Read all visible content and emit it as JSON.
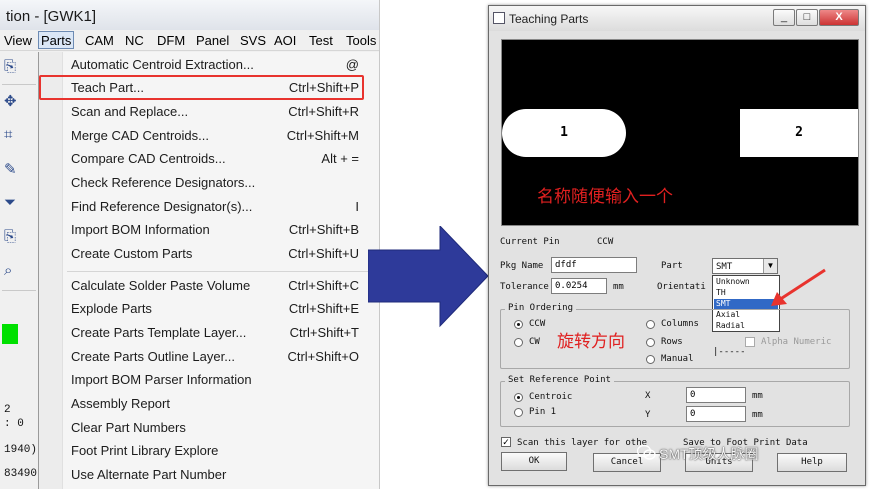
{
  "left_window": {
    "title": "tion - [GWK1]",
    "menubar": [
      "View",
      "Parts",
      "CAM",
      "NC",
      "DFM",
      "Panel",
      "SVS",
      "AOI",
      "Test",
      "Tools"
    ],
    "active_menu": "Parts",
    "toolbar_text": [
      "2",
      ": 0",
      "1940)",
      "83490)"
    ],
    "menu_items": [
      {
        "label": "Automatic Centroid Extraction...",
        "shortcut": "@"
      },
      {
        "label": "Teach Part...",
        "shortcut": "Ctrl+Shift+P"
      },
      {
        "label": "Scan and Replace...",
        "shortcut": "Ctrl+Shift+R"
      },
      {
        "label": "Merge CAD Centroids...",
        "shortcut": "Ctrl+Shift+M"
      },
      {
        "label": "Compare CAD Centroids...",
        "shortcut": "Alt + ="
      },
      {
        "label": "Check Reference Designators...",
        "shortcut": ""
      },
      {
        "label": "Find Reference Designator(s)...",
        "shortcut": "I"
      },
      {
        "label": "Import BOM Information",
        "shortcut": "Ctrl+Shift+B"
      },
      {
        "label": "Create Custom Parts",
        "shortcut": "Ctrl+Shift+U"
      },
      {
        "label": "Calculate Solder Paste Volume",
        "shortcut": "Ctrl+Shift+C"
      },
      {
        "label": "Explode Parts",
        "shortcut": "Ctrl+Shift+E"
      },
      {
        "label": "Create Parts Template Layer...",
        "shortcut": "Ctrl+Shift+T"
      },
      {
        "label": "Create Parts Outline Layer...",
        "shortcut": "Ctrl+Shift+O"
      },
      {
        "label": "Import BOM Parser Information",
        "shortcut": ""
      },
      {
        "label": "Assembly Report",
        "shortcut": ""
      },
      {
        "label": "Clear Part Numbers",
        "shortcut": ""
      },
      {
        "label": "Foot Print Library Explore",
        "shortcut": ""
      },
      {
        "label": "Use Alternate Part Number",
        "shortcut": ""
      }
    ],
    "highlighted_item": "Teach Part..."
  },
  "dialog": {
    "title": "Teaching Parts",
    "window_buttons": [
      "_",
      "□",
      "X"
    ],
    "preview": {
      "pad1": "1",
      "pad2": "2",
      "note": "名称随便输入一个"
    },
    "current_pin_label": "Current Pin",
    "current_pin_value": "CCW",
    "pkg_name_label": "Pkg Name",
    "pkg_name_value": "dfdf",
    "part_label": "Part",
    "part_value": "SMT",
    "part_options": [
      "Unknown",
      "TH",
      "SMT",
      "Axial",
      "Radial"
    ],
    "part_selected": "SMT",
    "tolerance_label": "Tolerance",
    "tolerance_value": "0.0254",
    "tolerance_unit": "mm",
    "orientation_label": "Orientati",
    "pin_ordering": {
      "title": "Pin Ordering",
      "ccw": "CCW",
      "cw": "CW",
      "columns": "Columns",
      "rows": "Rows",
      "manual": "Manual",
      "alpha_numeric": "Alpha Numeric",
      "separator": "|-----",
      "note": "旋转方向"
    },
    "ref_point": {
      "title": "Set Reference Point",
      "centroid": "Centroic",
      "pin1": "Pin 1",
      "x_label": "X",
      "x_value": "0",
      "y_label": "Y",
      "y_value": "0",
      "unit": "mm"
    },
    "scan_label": "Scan this layer for othe",
    "save_label": "Save to Foot Print Data",
    "buttons": {
      "ok": "OK",
      "cancel": "Cancel",
      "units": "Units",
      "help": "Help"
    },
    "watermark": "SMT顶级人脉圈"
  },
  "colors": {
    "highlight_box": "#e8332e",
    "arrow": "#2e3a9a",
    "annotation": "#e02020",
    "selection": "#3169c6"
  }
}
